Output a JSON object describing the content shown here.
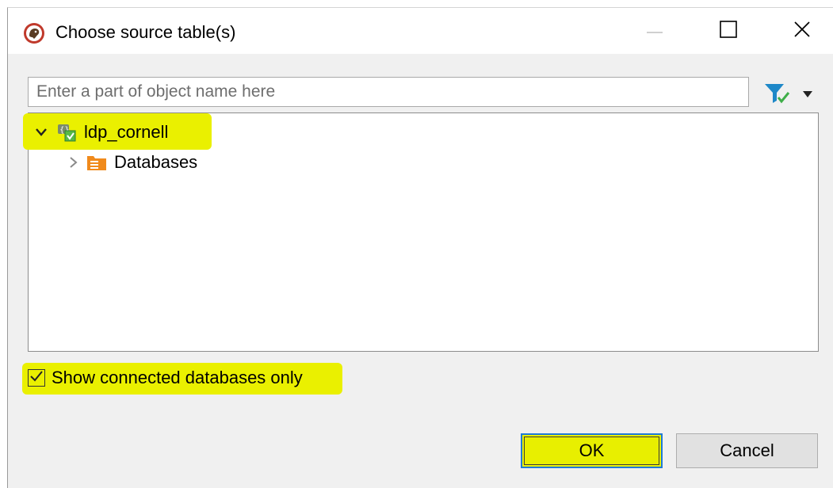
{
  "window": {
    "title": "Choose source table(s)",
    "app_icon": "dbeaver-beaver-icon"
  },
  "titlebar_buttons": {
    "minimize": "minimize-icon",
    "maximize": "maximize-icon",
    "close": "close-icon"
  },
  "search": {
    "placeholder": "Enter a part of object name here",
    "value": ""
  },
  "filter": {
    "icon": "filter-icon",
    "dropdown_icon": "caret-down-icon"
  },
  "tree": {
    "nodes": [
      {
        "label": "ldp_cornell",
        "expanded": true,
        "icon": "connection-icon",
        "highlighted": true
      },
      {
        "label": "Databases",
        "expanded": false,
        "icon": "databases-folder-icon",
        "highlighted": false
      }
    ]
  },
  "options": {
    "show_connected_label": "Show connected databases only",
    "show_connected_checked": true
  },
  "buttons": {
    "ok_label": "OK",
    "cancel_label": "Cancel"
  },
  "colors": {
    "highlight": "#eaf000",
    "focus_border": "#1f7ad6",
    "databases_icon": "#f08a1c",
    "connection_icon": "#4caf50"
  }
}
